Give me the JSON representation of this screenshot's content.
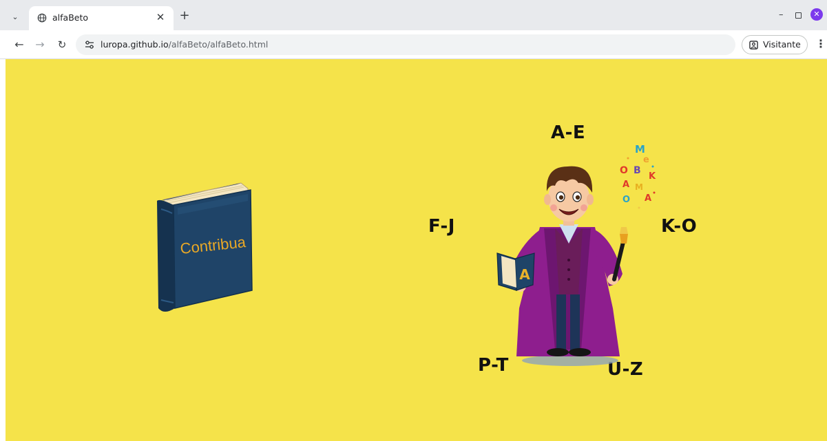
{
  "browser": {
    "tab_title": "alfaBeto",
    "url_host": "luropa.github.io",
    "url_path": "/alfaBeto/alfaBeto.html",
    "profile_label": "Visitante",
    "icons": [
      "tab-list-icon",
      "globe-icon",
      "close-icon",
      "plus-icon",
      "back-icon",
      "forward-icon",
      "reload-icon",
      "site-settings-icon",
      "profile-icon",
      "menu-icon",
      "minimize-icon",
      "maximize-icon",
      "window-close-icon"
    ]
  },
  "page": {
    "background": "#f5e34a",
    "book_label": "Contribua",
    "open_book_letter": "A",
    "ranges": {
      "ae": "A-E",
      "fj": "F-J",
      "ko": "K-O",
      "pt": "P-T",
      "uz": "U-Z"
    },
    "flying_letters": [
      "M",
      "e",
      "O",
      "B",
      "K",
      "A",
      "M",
      "O",
      "A"
    ]
  }
}
